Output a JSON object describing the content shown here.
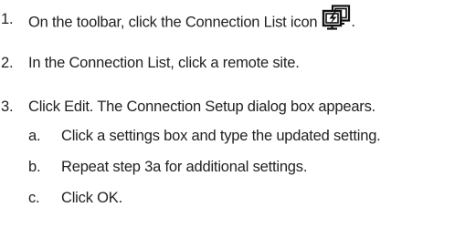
{
  "steps": [
    {
      "number": "1.",
      "text": "On the toolbar, click the Connection List icon",
      "icon": "connection-list-icon",
      "suffix": "."
    },
    {
      "number": "2.",
      "text": "In the Connection List, click a remote site."
    },
    {
      "number": "3.",
      "text": "Click Edit. The Connection Setup dialog box appears.",
      "substeps": [
        {
          "letter": "a.",
          "text": "Click a settings box and type the updated setting."
        },
        {
          "letter": "b.",
          "text": "Repeat step 3a for additional settings."
        },
        {
          "letter": "c.",
          "text": "Click OK."
        }
      ]
    }
  ],
  "colors": {
    "text": "#222222",
    "icon_stroke": "#111111"
  }
}
